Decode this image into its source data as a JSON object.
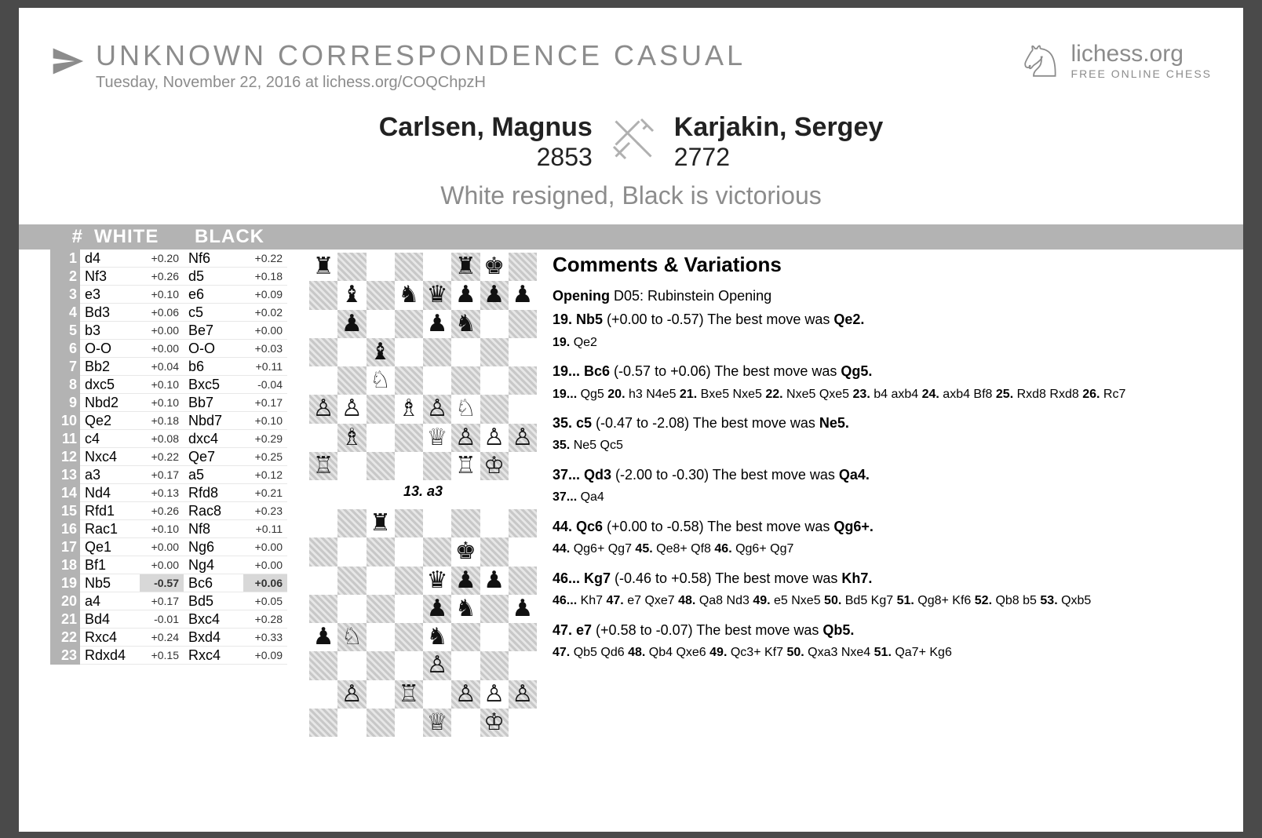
{
  "header": {
    "title": "UNKNOWN   CORRESPONDENCE   CASUAL",
    "subtitle": "Tuesday, November 22, 2016 at lichess.org/COQChpzH",
    "brand_main": "lichess.org",
    "brand_sub": "FREE ONLINE CHESS"
  },
  "match": {
    "white_name": "Carlsen, Magnus",
    "white_rating": "2853",
    "black_name": "Karjakin, Sergey",
    "black_rating": "2772",
    "result": "White resigned, Black is victorious"
  },
  "moves_header": {
    "num": "#",
    "white": "WHITE",
    "black": "BLACK"
  },
  "moves": [
    {
      "n": "1",
      "w": "d4",
      "we": "+0.20",
      "b": "Nf6",
      "be": "+0.22"
    },
    {
      "n": "2",
      "w": "Nf3",
      "we": "+0.26",
      "b": "d5",
      "be": "+0.18"
    },
    {
      "n": "3",
      "w": "e3",
      "we": "+0.10",
      "b": "e6",
      "be": "+0.09"
    },
    {
      "n": "4",
      "w": "Bd3",
      "we": "+0.06",
      "b": "c5",
      "be": "+0.02"
    },
    {
      "n": "5",
      "w": "b3",
      "we": "+0.00",
      "b": "Be7",
      "be": "+0.00"
    },
    {
      "n": "6",
      "w": "O-O",
      "we": "+0.00",
      "b": "O-O",
      "be": "+0.03"
    },
    {
      "n": "7",
      "w": "Bb2",
      "we": "+0.04",
      "b": "b6",
      "be": "+0.11"
    },
    {
      "n": "8",
      "w": "dxc5",
      "we": "+0.10",
      "b": "Bxc5",
      "be": "-0.04"
    },
    {
      "n": "9",
      "w": "Nbd2",
      "we": "+0.10",
      "b": "Bb7",
      "be": "+0.17"
    },
    {
      "n": "10",
      "w": "Qe2",
      "we": "+0.18",
      "b": "Nbd7",
      "be": "+0.10"
    },
    {
      "n": "11",
      "w": "c4",
      "we": "+0.08",
      "b": "dxc4",
      "be": "+0.29"
    },
    {
      "n": "12",
      "w": "Nxc4",
      "we": "+0.22",
      "b": "Qe7",
      "be": "+0.25"
    },
    {
      "n": "13",
      "w": "a3",
      "we": "+0.17",
      "b": "a5",
      "be": "+0.12"
    },
    {
      "n": "14",
      "w": "Nd4",
      "we": "+0.13",
      "b": "Rfd8",
      "be": "+0.21"
    },
    {
      "n": "15",
      "w": "Rfd1",
      "we": "+0.26",
      "b": "Rac8",
      "be": "+0.23"
    },
    {
      "n": "16",
      "w": "Rac1",
      "we": "+0.10",
      "b": "Nf8",
      "be": "+0.11"
    },
    {
      "n": "17",
      "w": "Qe1",
      "we": "+0.00",
      "b": "Ng6",
      "be": "+0.00"
    },
    {
      "n": "18",
      "w": "Bf1",
      "we": "+0.00",
      "b": "Ng4",
      "be": "+0.00"
    },
    {
      "n": "19",
      "w": "Nb5",
      "we": "-0.57",
      "b": "Bc6",
      "be": "+0.06",
      "hl": true
    },
    {
      "n": "20",
      "w": "a4",
      "we": "+0.17",
      "b": "Bd5",
      "be": "+0.05"
    },
    {
      "n": "21",
      "w": "Bd4",
      "we": "-0.01",
      "b": "Bxc4",
      "be": "+0.28"
    },
    {
      "n": "22",
      "w": "Rxc4",
      "we": "+0.24",
      "b": "Bxd4",
      "be": "+0.33"
    },
    {
      "n": "23",
      "w": "Rdxd4",
      "we": "+0.15",
      "b": "Rxc4",
      "be": "+0.09"
    }
  ],
  "board1": {
    "caption": "13. a3",
    "rows": [
      "r····rk·",
      "·b·nqppp",
      "·p··pn··",
      "··b·····",
      "··N·····",
      "PP·BPN··",
      "·B··QPPP",
      "R····RK·"
    ]
  },
  "board2": {
    "rows": [
      "··r····•",
      "·····k··",
      "···•qpp•",
      "····pn·p",
      "pN··n···",
      "····P···",
      "·P·R·PPP",
      "····Q·K·"
    ],
    "_note": "partial second diagram"
  },
  "comments": {
    "heading": "Comments & Variations",
    "opening_label": "Opening",
    "opening_text": " D05: Rubinstein Opening",
    "items": [
      {
        "lead": "19. Nb5",
        "eval": " (+0.00 to -0.57) The best move was ",
        "best": "Qe2.",
        "var": "19. Qe2"
      },
      {
        "lead": "19... Bc6",
        "eval": " (-0.57 to +0.06) The best move was ",
        "best": "Qg5.",
        "var": "19... Qg5 20. h3 N4e5 21. Bxe5 Nxe5 22. Nxe5 Qxe5 23. b4 axb4 24. axb4 Bf8 25. Rxd8 Rxd8 26. Rc7"
      },
      {
        "lead": "35. c5",
        "eval": " (-0.47 to -2.08) The best move was ",
        "best": "Ne5.",
        "var": "35. Ne5 Qc5"
      },
      {
        "lead": "37... Qd3",
        "eval": " (-2.00 to -0.30) The best move was ",
        "best": "Qa4.",
        "var": "37... Qa4"
      },
      {
        "lead": "44. Qc6",
        "eval": " (+0.00 to -0.58) The best move was ",
        "best": "Qg6+.",
        "var": "44. Qg6+ Qg7 45. Qe8+ Qf8 46. Qg6+ Qg7"
      },
      {
        "lead": "46... Kg7",
        "eval": " (-0.46 to +0.58) The best move was ",
        "best": "Kh7.",
        "var": "46... Kh7 47. e7 Qxe7 48. Qa8 Nd3 49. e5 Nxe5 50. Bd5 Kg7 51. Qg8+ Kf6 52. Qb8 b5 53. Qxb5"
      },
      {
        "lead": "47. e7",
        "eval": " (+0.58 to -0.07) The best move was ",
        "best": "Qb5.",
        "var": "47. Qb5 Qd6 48. Qb4 Qxe6 49. Qc3+ Kf7 50. Qxa3 Nxe4 51. Qa7+ Kg6"
      }
    ]
  }
}
